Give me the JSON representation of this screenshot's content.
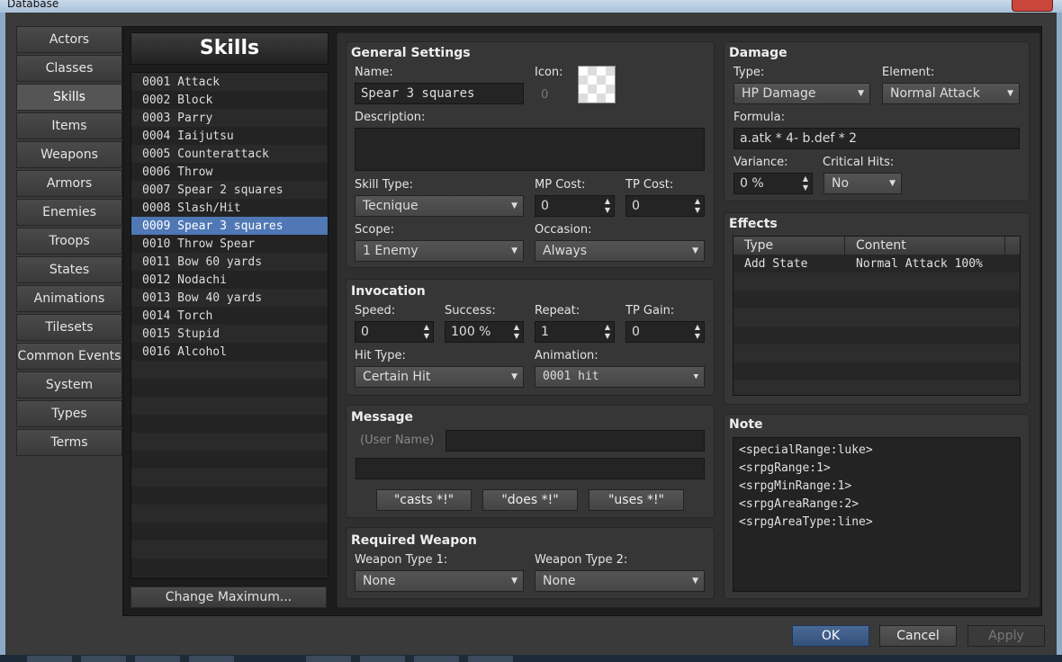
{
  "window": {
    "title": "Database"
  },
  "categories": [
    {
      "label": "Actors"
    },
    {
      "label": "Classes"
    },
    {
      "label": "Skills",
      "active": true
    },
    {
      "label": "Items"
    },
    {
      "label": "Weapons"
    },
    {
      "label": "Armors"
    },
    {
      "label": "Enemies"
    },
    {
      "label": "Troops"
    },
    {
      "label": "States"
    },
    {
      "label": "Animations"
    },
    {
      "label": "Tilesets"
    },
    {
      "label": "Common Events"
    },
    {
      "label": "System"
    },
    {
      "label": "Types"
    },
    {
      "label": "Terms"
    }
  ],
  "skills": {
    "title": "Skills",
    "items": [
      "0001 Attack",
      "0002 Block",
      "0003 Parry",
      "0004 Iaijutsu",
      "0005 Counterattack",
      "0006 Throw",
      "0007 Spear 2 squares",
      "0008 Slash/Hit",
      "0009 Spear 3 squares",
      "0010 Throw Spear",
      "0011 Bow 60 yards",
      "0012 Nodachi",
      "0013 Bow 40 yards",
      "0014 Torch",
      "0015 Stupid",
      "0016 Alcohol"
    ],
    "selected_index": 8,
    "change_max_label": "Change Maximum..."
  },
  "general": {
    "title": "General Settings",
    "name_label": "Name:",
    "name_value": "Spear 3 squares",
    "icon_label": "Icon:",
    "icon_index": "0",
    "description_label": "Description:",
    "description_value": "",
    "skill_type_label": "Skill Type:",
    "skill_type_value": "Tecnique",
    "mp_cost_label": "MP Cost:",
    "mp_cost_value": "0",
    "tp_cost_label": "TP Cost:",
    "tp_cost_value": "0",
    "scope_label": "Scope:",
    "scope_value": "1 Enemy",
    "occasion_label": "Occasion:",
    "occasion_value": "Always"
  },
  "invocation": {
    "title": "Invocation",
    "speed_label": "Speed:",
    "speed_value": "0",
    "success_label": "Success:",
    "success_value": "100 %",
    "repeat_label": "Repeat:",
    "repeat_value": "1",
    "tp_gain_label": "TP Gain:",
    "tp_gain_value": "0",
    "hit_type_label": "Hit Type:",
    "hit_type_value": "Certain Hit",
    "animation_label": "Animation:",
    "animation_value": "0001 hit"
  },
  "message": {
    "title": "Message",
    "user_name_placeholder": "(User Name)",
    "line1": "",
    "line2": "",
    "casts_label": "\"casts *!\"",
    "does_label": "\"does *!\"",
    "uses_label": "\"uses *!\""
  },
  "required_weapon": {
    "title": "Required Weapon",
    "type1_label": "Weapon Type 1:",
    "type1_value": "None",
    "type2_label": "Weapon Type 2:",
    "type2_value": "None"
  },
  "damage": {
    "title": "Damage",
    "type_label": "Type:",
    "type_value": "HP Damage",
    "element_label": "Element:",
    "element_value": "Normal Attack",
    "formula_label": "Formula:",
    "formula_value": "a.atk * 4- b.def * 2",
    "variance_label": "Variance:",
    "variance_value": "0 %",
    "critical_label": "Critical Hits:",
    "critical_value": "No"
  },
  "effects": {
    "title": "Effects",
    "col_type": "Type",
    "col_content": "Content",
    "rows": [
      {
        "type": "Add State",
        "content": "Normal Attack 100%"
      }
    ]
  },
  "note": {
    "title": "Note",
    "lines": [
      "<specialRange:luke>",
      "<srpgRange:1>",
      "<srpgMinRange:1>",
      "<srpgAreaRange:2>",
      "<srpgAreaType:line>"
    ]
  },
  "dialog": {
    "ok_label": "OK",
    "cancel_label": "Cancel",
    "apply_label": "Apply"
  },
  "colors": {
    "selection": "#4f78b5",
    "ok_button": "#3d5a80"
  }
}
